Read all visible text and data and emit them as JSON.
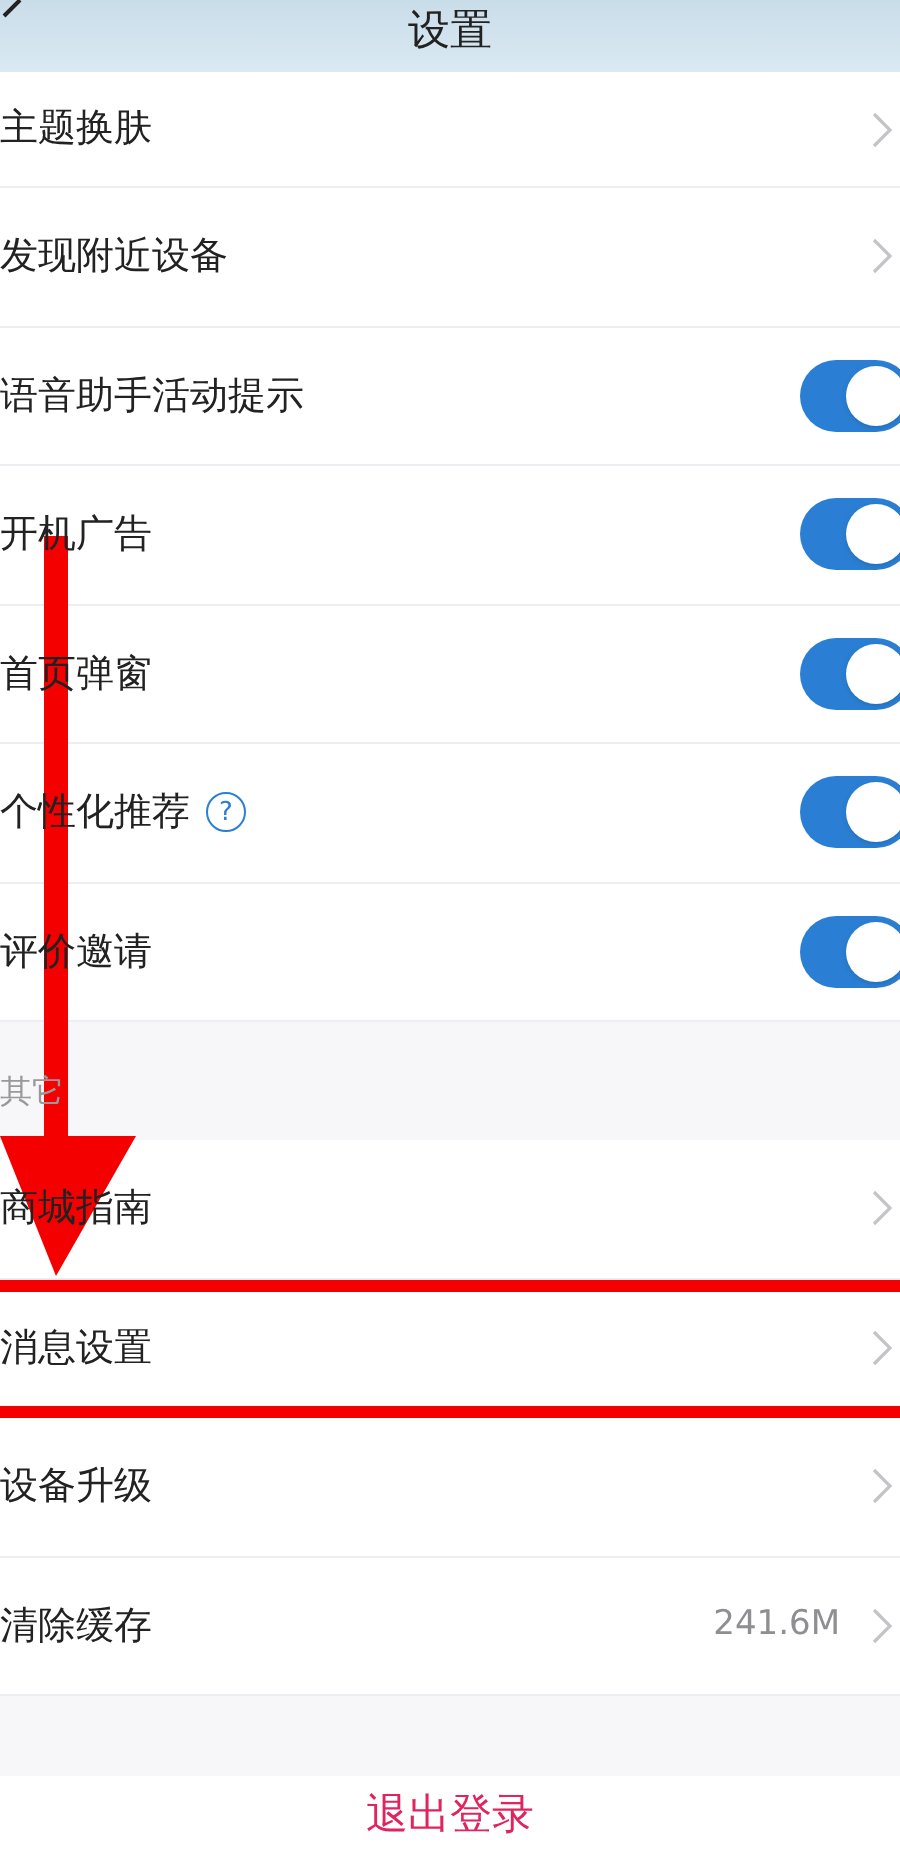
{
  "header": {
    "title": "设置"
  },
  "sections": [
    {
      "items": [
        {
          "kind": "link",
          "label": "主题换肤"
        },
        {
          "kind": "link",
          "label": "发现附近设备"
        },
        {
          "kind": "toggle",
          "label": "语音助手活动提示",
          "on": true
        },
        {
          "kind": "toggle",
          "label": "开机广告",
          "on": true
        },
        {
          "kind": "toggle",
          "label": "首页弹窗",
          "on": true
        },
        {
          "kind": "toggle",
          "label": "个性化推荐",
          "on": true,
          "help": "?"
        },
        {
          "kind": "toggle",
          "label": "评价邀请",
          "on": true
        }
      ]
    },
    {
      "title": "其它",
      "items": [
        {
          "kind": "link",
          "label": "商城指南",
          "highlighted": false
        },
        {
          "kind": "link",
          "label": "消息设置",
          "highlighted": true
        },
        {
          "kind": "link",
          "label": "设备升级"
        },
        {
          "kind": "link",
          "label": "清除缓存",
          "value": "241.6M"
        }
      ]
    }
  ],
  "logout": "退出登录"
}
